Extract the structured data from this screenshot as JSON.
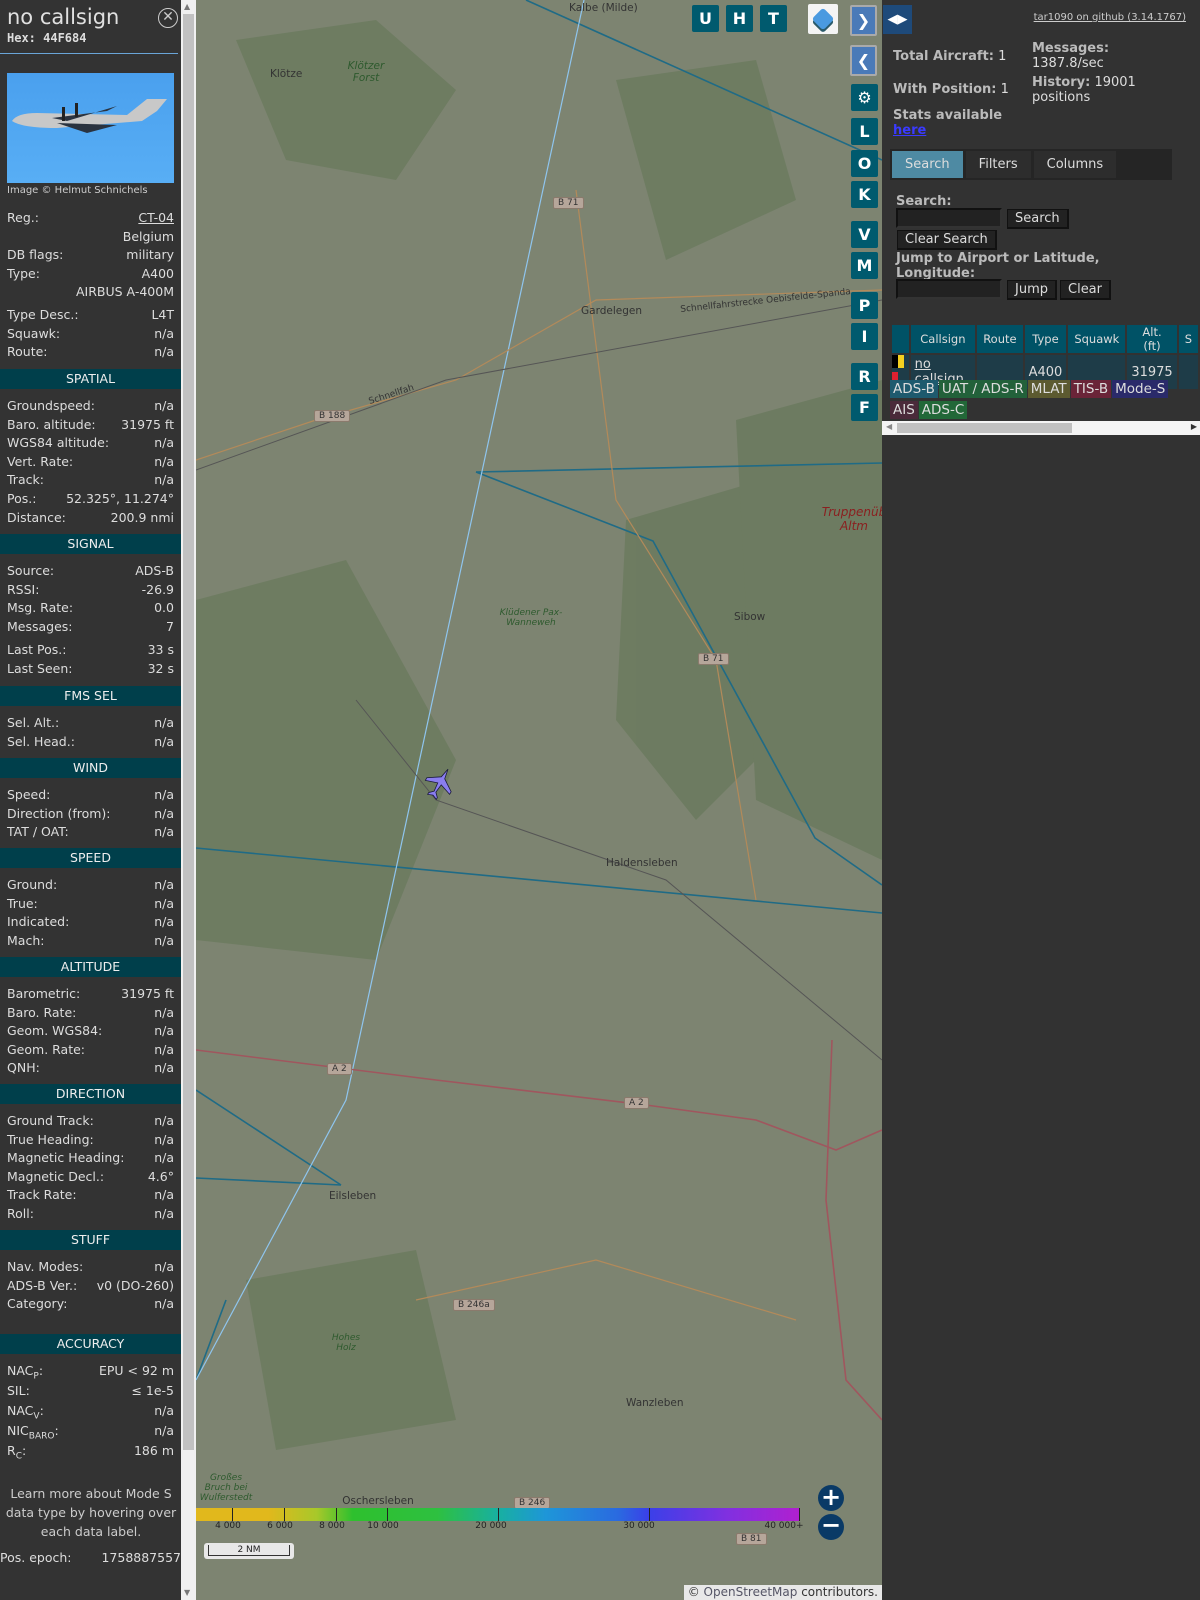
{
  "header": {
    "callsign": "no callsign",
    "hex": "Hex: 44F684",
    "photo_credit": "Image © Helmut Schnichels"
  },
  "info_rows": [
    [
      "Reg.:",
      "CT-04"
    ],
    [
      "",
      "Belgium"
    ],
    [
      "DB flags:",
      "military"
    ],
    [
      "Type:",
      "A400"
    ],
    [
      "",
      "AIRBUS A-400M"
    ],
    [
      "Type Desc.:",
      "L4T"
    ],
    [
      "Squawk:",
      "n/a"
    ],
    [
      "Route:",
      "n/a"
    ]
  ],
  "sections": [
    {
      "title": "SPATIAL",
      "rows": [
        [
          "Groundspeed:",
          "n/a"
        ],
        [
          "Baro. altitude:",
          "31975 ft"
        ],
        [
          "WGS84 altitude:",
          "n/a"
        ],
        [
          "Vert. Rate:",
          "n/a"
        ],
        [
          "Track:",
          "n/a"
        ],
        [
          "Pos.:",
          "52.325°, 11.274°"
        ],
        [
          "Distance:",
          "200.9 nmi"
        ]
      ]
    },
    {
      "title": "SIGNAL",
      "rows": [
        [
          "Source:",
          "ADS-B"
        ],
        [
          "RSSI:",
          "-26.9"
        ],
        [
          "Msg. Rate:",
          "0.0"
        ],
        [
          "Messages:",
          "7"
        ],
        [
          "",
          ""
        ],
        [
          "Last Pos.:",
          "33 s"
        ],
        [
          "Last Seen:",
          "32 s"
        ]
      ]
    },
    {
      "title": "FMS SEL",
      "rows": [
        [
          "Sel. Alt.:",
          "n/a"
        ],
        [
          "Sel. Head.:",
          "n/a"
        ]
      ]
    },
    {
      "title": "WIND",
      "rows": [
        [
          "Speed:",
          "n/a"
        ],
        [
          "Direction (from):",
          "n/a"
        ],
        [
          "TAT / OAT:",
          "n/a"
        ]
      ]
    },
    {
      "title": "SPEED",
      "rows": [
        [
          "Ground:",
          "n/a"
        ],
        [
          "True:",
          "n/a"
        ],
        [
          "Indicated:",
          "n/a"
        ],
        [
          "Mach:",
          "n/a"
        ]
      ]
    },
    {
      "title": "ALTITUDE",
      "rows": [
        [
          "Barometric:",
          "31975 ft"
        ],
        [
          "Baro. Rate:",
          "n/a"
        ],
        [
          "Geom. WGS84:",
          "n/a"
        ],
        [
          "Geom. Rate:",
          "n/a"
        ],
        [
          "QNH:",
          "n/a"
        ]
      ]
    },
    {
      "title": "DIRECTION",
      "rows": [
        [
          "Ground Track:",
          "n/a"
        ],
        [
          "True Heading:",
          "n/a"
        ],
        [
          "Magnetic Heading:",
          "n/a"
        ],
        [
          "Magnetic Decl.:",
          "4.6°"
        ],
        [
          "Track Rate:",
          "n/a"
        ],
        [
          "Roll:",
          "n/a"
        ]
      ]
    },
    {
      "title": "STUFF",
      "rows": [
        [
          "Nav. Modes:",
          "n/a"
        ],
        [
          "ADS-B Ver.:",
          "v0 (DO-260)"
        ],
        [
          "Category:",
          "n/a"
        ]
      ]
    },
    {
      "title": "ACCURACY",
      "rows": [
        [
          "NAC",
          "EPU < 92 m",
          "P"
        ],
        [
          "SIL:",
          "≤ 1e-5"
        ],
        [
          "NAC",
          "n/a",
          "V"
        ],
        [
          "NIC",
          "n/a",
          "BARO"
        ],
        [
          "R",
          "186 m",
          "C"
        ]
      ]
    }
  ],
  "learn_more": "Learn more about Mode S data type by hovering over each data label.",
  "epoch": {
    "label": "Pos. epoch:",
    "value": "1758887557"
  },
  "map": {
    "top_buttons": [
      "U",
      "H",
      "T"
    ],
    "side_buttons": [
      "L",
      "O",
      "K",
      "V",
      "M",
      "P",
      "I",
      "R",
      "F"
    ],
    "places": [
      "Kalbe (Milde)",
      "Klötze",
      "Klötzer Forst",
      "Gardelegen",
      "Haldensleben",
      "Eilsleben",
      "Wanzleben",
      "Oschersleben (Bode)",
      "Sibow",
      "Klüdener Pax-Wanneweh",
      "Hohes Holz",
      "Großes Bruch bei Wulferstedt",
      "Truppenüb Altm",
      "Schnellfahrstrecke Oebisfelde-Spanda",
      "Schnellfah"
    ],
    "roads": [
      "B 71",
      "B 188",
      "B 71",
      "A 2",
      "A 2",
      "B 246a",
      "B 246",
      "B 81"
    ],
    "altitude_scale": [
      "4 000",
      "6 000",
      "8 000",
      "10 000",
      "20 000",
      "30 000",
      "40 000+"
    ],
    "scale_bar": "2 NM",
    "attribution_prefix": "© ",
    "attribution_link": "OpenStreetMap",
    "attribution_suffix": " contributors."
  },
  "right": {
    "github": "tar1090 on github (3.14.1767)",
    "total_label": "Total Aircraft:",
    "total": " 1",
    "withpos_label": "With Position:",
    "withpos": " 1",
    "messages_label": "Messages:",
    "messages": "1387.8/sec",
    "history_label": "History:",
    "history": " 19001 positions",
    "stats_label": "Stats available",
    "stats_link": "here",
    "tabs": [
      "Search",
      "Filters",
      "Columns"
    ],
    "search_label": "Search:",
    "search_btn": "Search",
    "clear_search_btn": "Clear Search",
    "jump_label": "Jump to Airport or Latitude, Longitude:",
    "jump_btn": "Jump",
    "clear_btn": "Clear",
    "columns": [
      "",
      "Callsign",
      "Route",
      "Type",
      "Squawk",
      "Alt. (ft)",
      "S"
    ],
    "row": {
      "callsign": "no callsign",
      "route": "",
      "type": "A400",
      "squawk": "",
      "alt": "31975"
    },
    "sources": [
      {
        "name": "ADS-B",
        "color": "#1e5a6e"
      },
      {
        "name": "UAT / ADS-R",
        "color": "#22613a"
      },
      {
        "name": "MLAT",
        "color": "#5c5a30"
      },
      {
        "name": "TIS-B",
        "color": "#6a2438"
      },
      {
        "name": "Mode-S",
        "color": "#2a2a6a"
      },
      {
        "name": "AIS",
        "color": "#4a2a3a"
      },
      {
        "name": "ADS-C",
        "color": "#226838"
      }
    ]
  }
}
